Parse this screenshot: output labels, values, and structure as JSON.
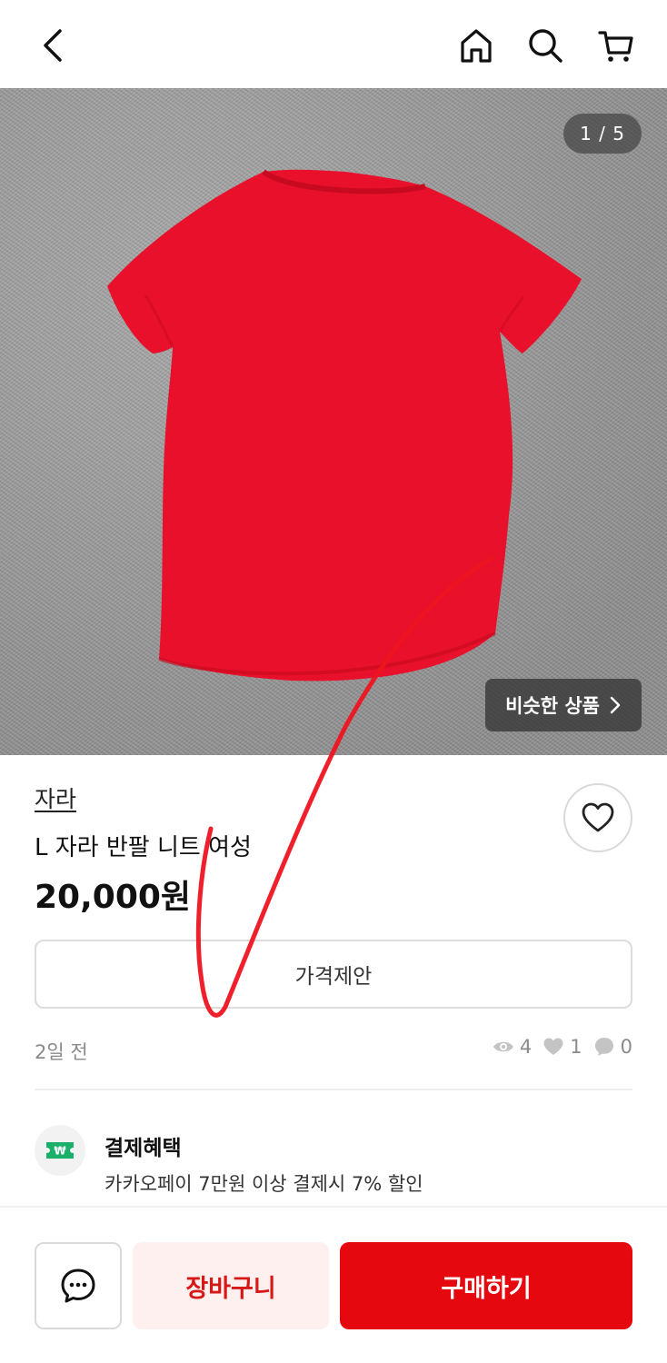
{
  "header": {
    "back_icon": "chevron-left-icon",
    "home_icon": "home-icon",
    "search_icon": "search-icon",
    "cart_icon": "cart-icon"
  },
  "gallery": {
    "counter": "1 / 5",
    "similar_label": "비슷한 상품",
    "product_color": "#e8102a"
  },
  "product": {
    "brand": "자라",
    "title": "L 자라 반팔 니트 여성",
    "price": "20,000원"
  },
  "offer": {
    "label": "가격제안"
  },
  "meta": {
    "time": "2일 전",
    "views": "4",
    "likes": "1",
    "chats": "0"
  },
  "payment": {
    "title": "결제혜택",
    "description": "카카오페이 7만원 이상 결제시 7% 할인",
    "icon": "ticket-icon",
    "icon_color": "#1bb06a"
  },
  "actions": {
    "chat_icon": "chat-icon",
    "cart_label": "장바구니",
    "buy_label": "구매하기",
    "accent": "#e5080e"
  }
}
